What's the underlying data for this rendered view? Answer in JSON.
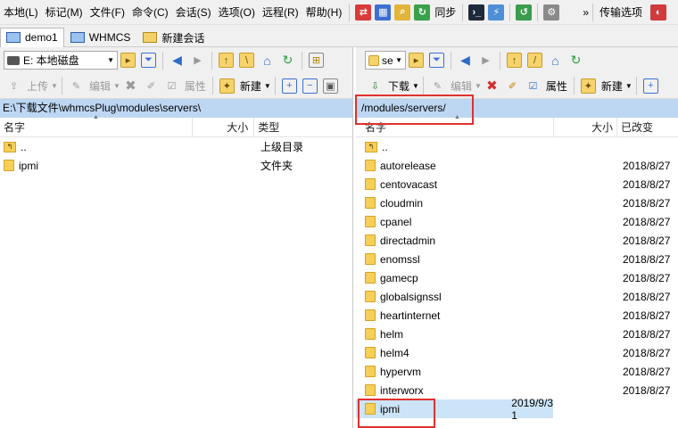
{
  "menubar": {
    "items": [
      "本地(L)",
      "标记(M)",
      "文件(F)",
      "命令(C)",
      "会话(S)",
      "选项(O)",
      "远程(R)",
      "帮助(H)"
    ],
    "sync_label": "同步",
    "transfer_label": "传输选项",
    "overflow": "»"
  },
  "tabs": [
    {
      "label": "demo1",
      "active": true
    },
    {
      "label": "WHMCS",
      "active": false
    },
    {
      "label": "新建会话",
      "active": false
    }
  ],
  "left": {
    "drive": "E: 本地磁盘",
    "toolbar": {
      "upload": "上传",
      "edit": "编辑",
      "properties": "属性",
      "new": "新建"
    },
    "path": "E:\\下载文件\\whmcsPlug\\modules\\servers\\",
    "columns": {
      "name": "名字",
      "size": "大小",
      "type": "类型"
    },
    "rows": [
      {
        "name": "..",
        "type": "上级目录",
        "up": true
      },
      {
        "name": "ipmi",
        "type": "文件夹",
        "up": false
      }
    ]
  },
  "right": {
    "drive": "se",
    "toolbar": {
      "download": "下载",
      "edit": "编辑",
      "properties": "属性",
      "new": "新建"
    },
    "path": "/modules/servers/",
    "columns": {
      "name": "名字",
      "size": "大小",
      "modified": "已改变"
    },
    "rows": [
      {
        "name": "..",
        "date": "",
        "up": true
      },
      {
        "name": "autorelease",
        "date": "2018/8/27"
      },
      {
        "name": "centovacast",
        "date": "2018/8/27"
      },
      {
        "name": "cloudmin",
        "date": "2018/8/27"
      },
      {
        "name": "cpanel",
        "date": "2018/8/27"
      },
      {
        "name": "directadmin",
        "date": "2018/8/27"
      },
      {
        "name": "enomssl",
        "date": "2018/8/27"
      },
      {
        "name": "gamecp",
        "date": "2018/8/27"
      },
      {
        "name": "globalsignssl",
        "date": "2018/8/27"
      },
      {
        "name": "heartinternet",
        "date": "2018/8/27"
      },
      {
        "name": "helm",
        "date": "2018/8/27"
      },
      {
        "name": "helm4",
        "date": "2018/8/27"
      },
      {
        "name": "hypervm",
        "date": "2018/8/27"
      },
      {
        "name": "interworx",
        "date": "2018/8/27"
      },
      {
        "name": "ipmi",
        "date": "2019/9/3 1",
        "selected": true
      }
    ]
  },
  "colors": {
    "path_bg": "#bdd7f3",
    "highlight": "#e0312f",
    "selection": "#cce4f7"
  }
}
